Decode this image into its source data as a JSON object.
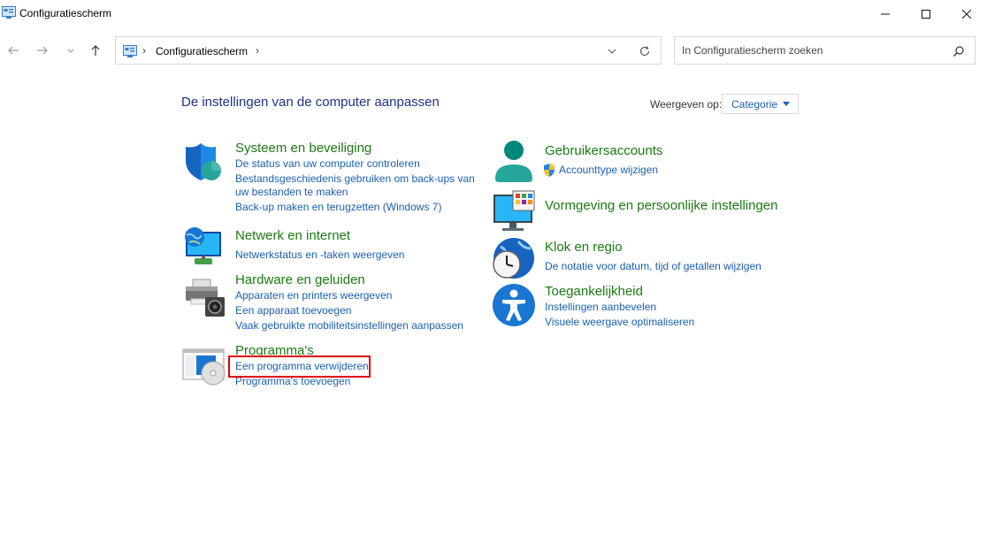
{
  "window": {
    "title": "Configuratiescherm",
    "minimize_icon": "minimize-icon",
    "maximize_icon": "maximize-icon",
    "close_icon": "close-icon"
  },
  "navigation": {
    "back_icon": "arrow-left-icon",
    "forward_icon": "arrow-right-icon",
    "recent_icon": "chevron-down-icon",
    "up_icon": "arrow-up-icon",
    "address": {
      "separator": "›",
      "path": "Configuratiescherm",
      "dropdown_icon": "chevron-down-icon",
      "refresh_icon": "refresh-icon"
    },
    "search": {
      "placeholder": "In Configuratiescherm zoeken",
      "icon": "search-icon"
    }
  },
  "main": {
    "title": "De instellingen van de computer aanpassen",
    "view_by": {
      "label": "Weergeven op:",
      "selected": "Categorie"
    },
    "left_categories": [
      {
        "title": "Systeem en beveiliging",
        "icon": "shield-icon",
        "links": [
          "De status van uw computer controleren",
          "Bestandsgeschiedenis gebruiken om back-ups van",
          "uw bestanden te maken",
          "Back-up maken en terugzetten (Windows 7)"
        ]
      },
      {
        "title": "Netwerk en internet",
        "icon": "network-globe-icon",
        "links": [
          "Netwerkstatus en -taken weergeven"
        ]
      },
      {
        "title": "Hardware en geluiden",
        "icon": "printer-speaker-icon",
        "links": [
          "Apparaten en printers weergeven",
          "Een apparaat toevoegen",
          "Vaak gebruikte mobiliteitsinstellingen aanpassen"
        ]
      },
      {
        "title": "Programma's",
        "icon": "programs-disc-icon",
        "links": [
          "Een programma verwijderen",
          "Programma's toevoegen"
        ]
      }
    ],
    "right_categories": [
      {
        "title": "Gebruikersaccounts",
        "icon": "user-accounts-icon",
        "links": [
          "Accounttype wijzigen"
        ],
        "link_icon": "uac-shield-icon"
      },
      {
        "title": "Vormgeving en persoonlijke instellingen",
        "icon": "monitor-personalize-icon",
        "links": []
      },
      {
        "title": "Klok en regio",
        "icon": "clock-globe-icon",
        "links": [
          "De notatie voor datum, tijd of getallen wijzigen"
        ]
      },
      {
        "title": "Toegankelijkheid",
        "icon": "accessibility-icon",
        "links": [
          "Instellingen aanbevelen",
          "Visuele weergave optimaliseren"
        ]
      }
    ]
  },
  "colors": {
    "category_title": "#1b7b12",
    "link": "#1a5fb4",
    "page_title": "#1e3287",
    "highlight": "#e00000"
  }
}
